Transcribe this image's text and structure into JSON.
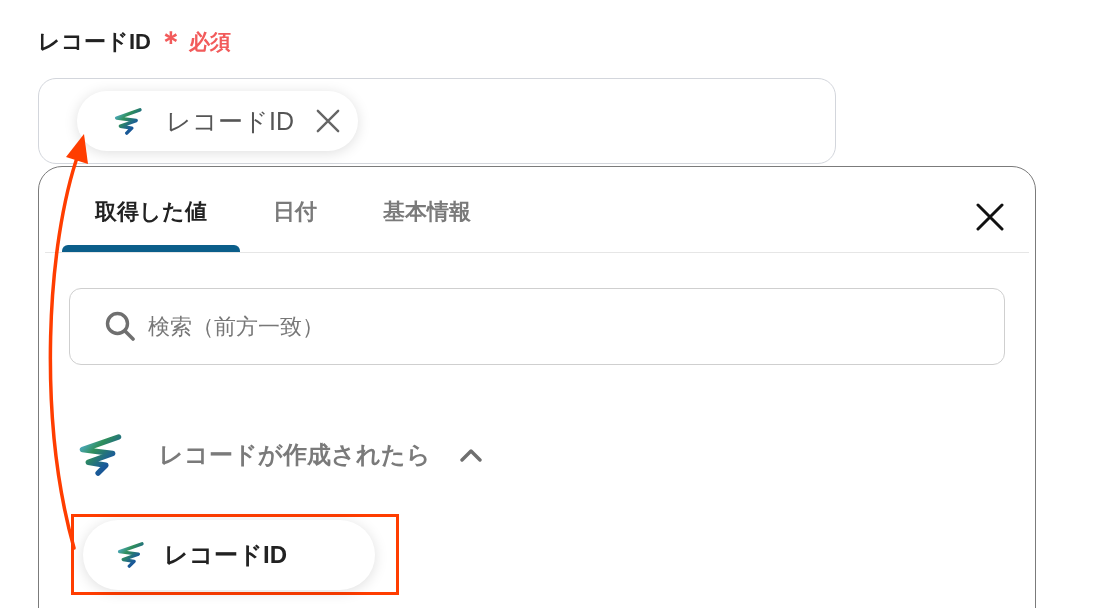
{
  "field": {
    "label": "レコードID",
    "required_mark": "＊",
    "required_text": "必須",
    "chip": {
      "text": "レコードID",
      "removable": true
    }
  },
  "picker": {
    "tabs": [
      {
        "label": "取得した値",
        "selected": true
      },
      {
        "label": "日付",
        "selected": false
      },
      {
        "label": "基本情報",
        "selected": false
      }
    ],
    "search": {
      "placeholder": "検索（前方一致）"
    },
    "groups": [
      {
        "title": "レコードが作成されたら",
        "expanded": true,
        "items": [
          {
            "label": "レコードID",
            "highlighted": true
          }
        ]
      }
    ]
  }
}
